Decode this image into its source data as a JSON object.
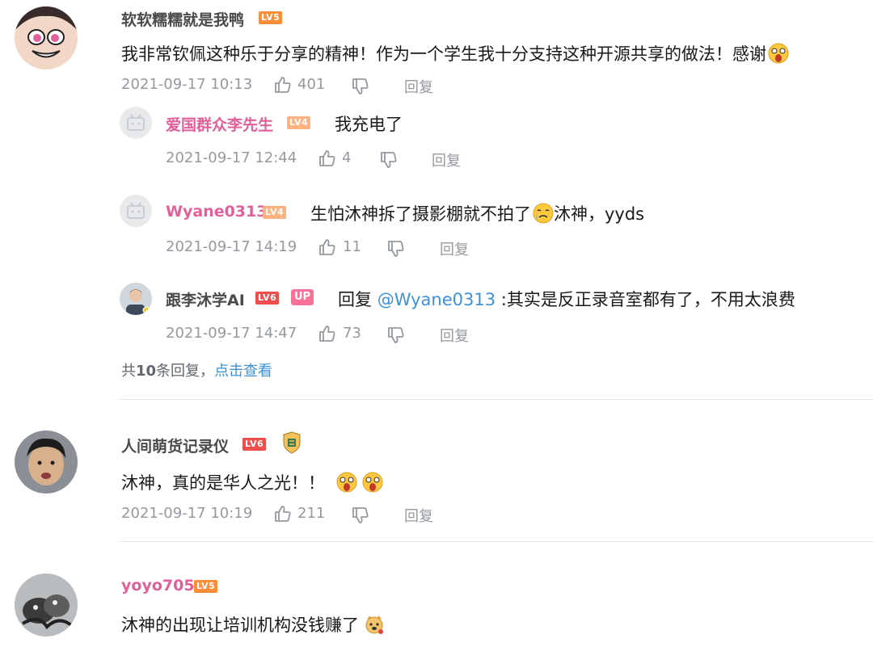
{
  "comments": [
    {
      "user": "软软糯糯就是我鸭",
      "level": "LV5",
      "text": "我非常钦佩这种乐于分享的精神！作为一个学生我十分支持这种开源共享的做法！感谢",
      "time": "2021-09-17 10:13",
      "likes": "401",
      "reply_label": "回复",
      "replies": [
        {
          "user": "爱国群众李先生",
          "level": "LV4",
          "text": "我充电了",
          "time": "2021-09-17 12:44",
          "likes": "4",
          "reply_label": "回复"
        },
        {
          "user": "Wyane0313",
          "level": "LV4",
          "text": "生怕沐神拆了摄影棚就不拍了",
          "text_after_emoji": "沐神，yyds",
          "time": "2021-09-17 14:19",
          "likes": "11",
          "reply_label": "回复"
        },
        {
          "user": "跟李沐学AI",
          "level": "LV6",
          "badge": "UP",
          "reply_prefix": "回复",
          "mention": "@Wyane0313",
          "text": ":其实是反正录音室都有了，不用太浪费",
          "time": "2021-09-17 14:47",
          "likes": "73",
          "reply_label": "回复"
        }
      ],
      "more_prefix": "共",
      "more_count": "10",
      "more_suffix": "条回复，",
      "more_link": "点击查看"
    },
    {
      "user": "人间萌货记录仪",
      "level": "LV6",
      "text": "沐神，真的是华人之光！！",
      "time": "2021-09-17 10:19",
      "likes": "211",
      "reply_label": "回复"
    },
    {
      "user": "yoyo705",
      "level": "LV5",
      "text": "沐神的出现让培训机构没钱赚了"
    }
  ],
  "icons": {
    "like": "thumbs-up-icon",
    "dislike": "thumbs-down-icon",
    "default_avatar": "bilibili-tv-avatar-icon",
    "medal": "medal-badge-icon",
    "emoji_surprised": "surprised-face-emoji",
    "emoji_cry": "crying-face-emoji",
    "emoji_dog": "dog-face-emoji"
  },
  "colors": {
    "username_pink": "#e0619a",
    "meta_gray": "#9499a0",
    "link_blue": "#3c91d8",
    "lv4": "#ffb27f",
    "lv5": "#ff8d3a",
    "lv6": "#f24d4d",
    "up_badge": "#fb7299"
  }
}
